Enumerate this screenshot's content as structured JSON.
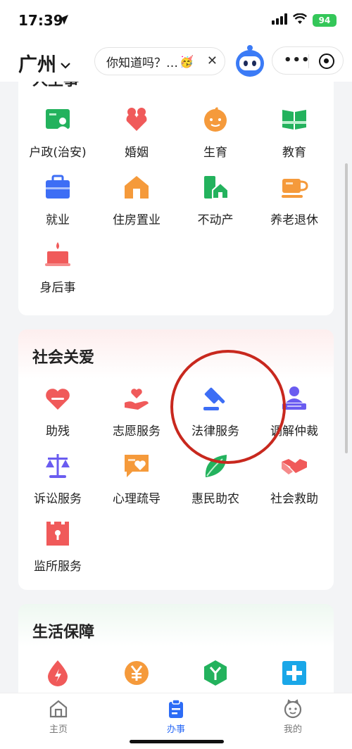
{
  "status": {
    "time": "17:39",
    "battery": "94"
  },
  "nav": {
    "city": "广州",
    "tip_text": "你知道吗？…",
    "tip_emoji": "🥳",
    "close_symbol": "✕",
    "more_symbol": "•••"
  },
  "sections": {
    "life_events": {
      "title": "人生事",
      "items": [
        {
          "label": "户政(治安)",
          "icon": "household-icon",
          "color": "#23b25d"
        },
        {
          "label": "婚姻",
          "icon": "marriage-icon",
          "color": "#f05a5a"
        },
        {
          "label": "生育",
          "icon": "baby-icon",
          "color": "#f59a3b"
        },
        {
          "label": "教育",
          "icon": "book-icon",
          "color": "#23b25d"
        },
        {
          "label": "就业",
          "icon": "briefcase-icon",
          "color": "#3d6ef5"
        },
        {
          "label": "住房置业",
          "icon": "house-icon",
          "color": "#f59a3b"
        },
        {
          "label": "不动产",
          "icon": "property-icon",
          "color": "#23b25d"
        },
        {
          "label": "养老退休",
          "icon": "teacup-icon",
          "color": "#f59a3b"
        },
        {
          "label": "身后事",
          "icon": "candle-icon",
          "color": "#f05a5a"
        }
      ]
    },
    "social_care": {
      "title": "社会关爱",
      "items": [
        {
          "label": "助残",
          "icon": "heart-icon",
          "color": "#f05a5a"
        },
        {
          "label": "志愿服务",
          "icon": "hand-heart-icon",
          "color": "#f05a5a"
        },
        {
          "label": "法律服务",
          "icon": "gavel-icon",
          "color": "#3d6ef5"
        },
        {
          "label": "调解仲裁",
          "icon": "mediation-icon",
          "color": "#6a5cf0"
        },
        {
          "label": "诉讼服务",
          "icon": "scales-icon",
          "color": "#6a5cf0"
        },
        {
          "label": "心理疏导",
          "icon": "chat-heart-icon",
          "color": "#f59a3b"
        },
        {
          "label": "惠民助农",
          "icon": "leaf-icon",
          "color": "#23b25d"
        },
        {
          "label": "社会救助",
          "icon": "handshake-icon",
          "color": "#f05a5a"
        },
        {
          "label": "监所服务",
          "icon": "prison-icon",
          "color": "#f05a5a"
        }
      ]
    },
    "life_security": {
      "title": "生活保障",
      "items": [
        {
          "label": "",
          "icon": "water-drop-icon",
          "color": "#f05a5a"
        },
        {
          "label": "",
          "icon": "yuan-icon",
          "color": "#f59a3b"
        },
        {
          "label": "",
          "icon": "hexagon-y-icon",
          "color": "#23b25d"
        },
        {
          "label": "",
          "icon": "medical-cross-icon",
          "color": "#1aa7e8"
        }
      ]
    }
  },
  "tabs": [
    {
      "label": "主页",
      "icon": "home-icon",
      "active": false
    },
    {
      "label": "办事",
      "icon": "clipboard-icon",
      "active": true
    },
    {
      "label": "我的",
      "icon": "profile-icon",
      "active": false
    }
  ],
  "colors": {
    "accent": "#2d6cf6",
    "highlight_circle": "#c8281e"
  }
}
